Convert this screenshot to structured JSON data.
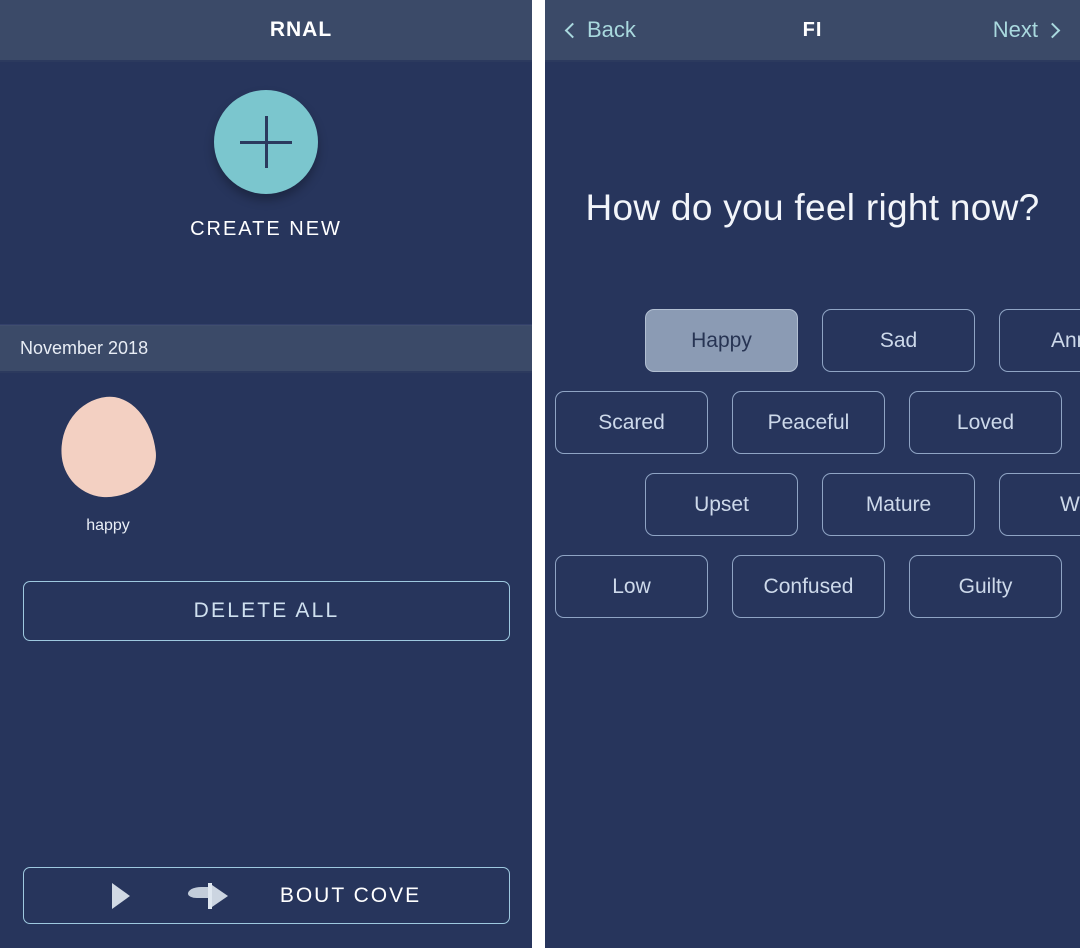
{
  "left_screen": {
    "navbar": {
      "title": "RNAL"
    },
    "create": {
      "icon": "plus-icon",
      "label": "CREATE NEW"
    },
    "month_header": "November 2018",
    "entries": [
      {
        "mood_label": "happy",
        "blob_color": "#f3d0c2"
      }
    ],
    "delete_button": "DELETE ALL",
    "about_bar": {
      "label": "BOUT COVE",
      "icon_1": "play-triangle-icon",
      "icon_2": "flag-play-icon"
    }
  },
  "right_screen": {
    "navbar": {
      "back_label": "Back",
      "title": "FI",
      "next_label": "Next",
      "back_icon": "chevron-left-icon",
      "next_icon": "chevron-right-icon"
    },
    "question": "How do you feel right now?",
    "mood_rows": [
      [
        {
          "label": "Happy",
          "selected": true
        },
        {
          "label": "Sad",
          "selected": false
        },
        {
          "label": "Anno",
          "selected": false
        }
      ],
      [
        {
          "label": "Scared",
          "selected": false
        },
        {
          "label": "Peaceful",
          "selected": false
        },
        {
          "label": "Loved",
          "selected": false
        }
      ],
      [
        {
          "label": "Upset",
          "selected": false
        },
        {
          "label": "Mature",
          "selected": false
        },
        {
          "label": "We",
          "selected": false
        }
      ],
      [
        {
          "label": "Low",
          "selected": false
        },
        {
          "label": "Confused",
          "selected": false
        },
        {
          "label": "Guilty",
          "selected": false
        }
      ]
    ]
  },
  "colors": {
    "background": "#27355c",
    "navbar": "#3b4a68",
    "accent_teal": "#7bc6ce",
    "accent_text": "#a9d9de",
    "chip_border": "#8fa4c4",
    "chip_selected_bg": "#8b9bb4",
    "blob": "#f3d0c2"
  }
}
